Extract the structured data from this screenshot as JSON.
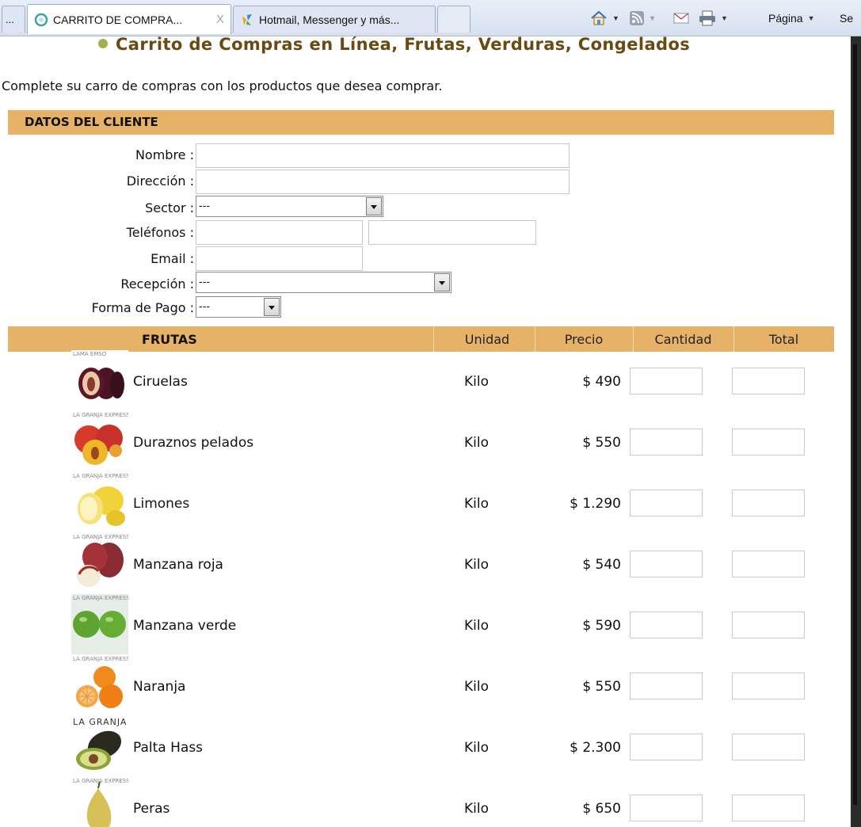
{
  "browser": {
    "prev_tab_label": "...",
    "active_tab_title": "CARRITO DE COMPRA...",
    "active_tab_close": "X",
    "hotmail_tab_title": "Hotmail, Messenger y más...",
    "page_menu_label": "Página",
    "safety_menu_label": "Se"
  },
  "page": {
    "title": "Carrito de Compras en Línea, Frutas, Verduras, Congelados",
    "intro": "Complete su carro de compras con los productos que desea comprar."
  },
  "customer": {
    "section_title": "DATOS DEL CLIENTE",
    "nombre_label": "Nombre :",
    "direccion_label": "Dirección :",
    "sector_label": "Sector :",
    "sector_value": "---",
    "telefonos_label": "Teléfonos :",
    "email_label": "Email :",
    "recepcion_label": "Recepción :",
    "recepcion_value": "---",
    "pago_label": "Forma de Pago :",
    "pago_value": "---"
  },
  "table": {
    "section": "FRUTAS",
    "col_unidad": "Unidad",
    "col_precio": "Precio",
    "col_cantidad": "Cantidad",
    "col_total": "Total"
  },
  "products": [
    {
      "name": "Ciruelas",
      "unit": "Kilo",
      "price": "$ 490",
      "thumb_text": "LAMA EMSO",
      "thumb_icon": "plum-icon"
    },
    {
      "name": "Duraznos pelados",
      "unit": "Kilo",
      "price": "$ 550",
      "thumb_text": "LA GRANJA EXPRESS",
      "thumb_icon": "peach-icon"
    },
    {
      "name": "Limones",
      "unit": "Kilo",
      "price": "$ 1.290",
      "thumb_text": "LA GRANJA EXPRESS",
      "thumb_icon": "lemon-icon"
    },
    {
      "name": "Manzana roja",
      "unit": "Kilo",
      "price": "$ 540",
      "thumb_text": "LA GRANJA EXPRESS",
      "thumb_icon": "red-apple-icon"
    },
    {
      "name": "Manzana verde",
      "unit": "Kilo",
      "price": "$ 590",
      "thumb_text": "LA GRANJA EXPRESS",
      "thumb_icon": "green-apple-icon"
    },
    {
      "name": "Naranja",
      "unit": "Kilo",
      "price": "$ 550",
      "thumb_text": "LA GRANJA EXPRESS",
      "thumb_icon": "orange-icon"
    },
    {
      "name": "Palta Hass",
      "unit": "Kilo",
      "price": "$ 2.300",
      "thumb_text": "LA GRANJA",
      "thumb_icon": "avocado-icon"
    },
    {
      "name": "Peras",
      "unit": "Kilo",
      "price": "$ 650",
      "thumb_text": "LA GRANJA EXPRESS",
      "thumb_icon": "pear-icon"
    }
  ]
}
